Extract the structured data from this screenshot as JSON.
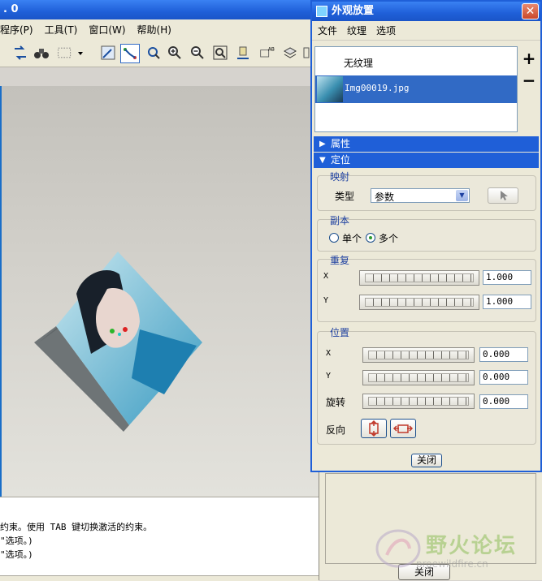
{
  "main_window": {
    "title_fragment": ". 0",
    "menu": [
      "程序(P)",
      "工具(T)",
      "窗口(W)",
      "帮助(H)"
    ],
    "message_lines": [
      "约束。使用 TAB 键切换激活的约束。",
      "\"选项。)",
      "\"选项。)"
    ]
  },
  "dialog": {
    "title": "外观放置",
    "close_glyph": "✕",
    "menu": [
      "文件",
      "纹理",
      "选项"
    ],
    "texture_list": [
      {
        "label": "无纹理",
        "selected": false
      },
      {
        "label": "Img00019.jpg",
        "selected": true
      }
    ],
    "add_glyph": "+",
    "remove_glyph": "−",
    "sections": {
      "properties": "属性",
      "placement": "定位"
    },
    "mapping": {
      "group": "映射",
      "type_label": "类型",
      "type_value": "参数"
    },
    "copies": {
      "group": "副本",
      "single": "单个",
      "multiple": "多个",
      "selected": "multiple"
    },
    "repeat": {
      "group": "重复",
      "x_label": "X",
      "x_value": "1.000",
      "y_label": "Y",
      "y_value": "1.000"
    },
    "position": {
      "group": "位置",
      "x_label": "X",
      "x_value": "0.000",
      "y_label": "Y",
      "y_value": "0.000",
      "rotate_label": "旋转",
      "rotate_value": "0.000",
      "reverse_label": "反向"
    },
    "close_button": "关闭"
  },
  "background_window": {
    "close_button": "关闭"
  },
  "watermark": {
    "text": "野火论坛",
    "url": "proewildfire.cn"
  },
  "colors": {
    "titlebar": "#1f5fd8",
    "selection": "#316ac5",
    "group_label": "#1c3fa0"
  }
}
